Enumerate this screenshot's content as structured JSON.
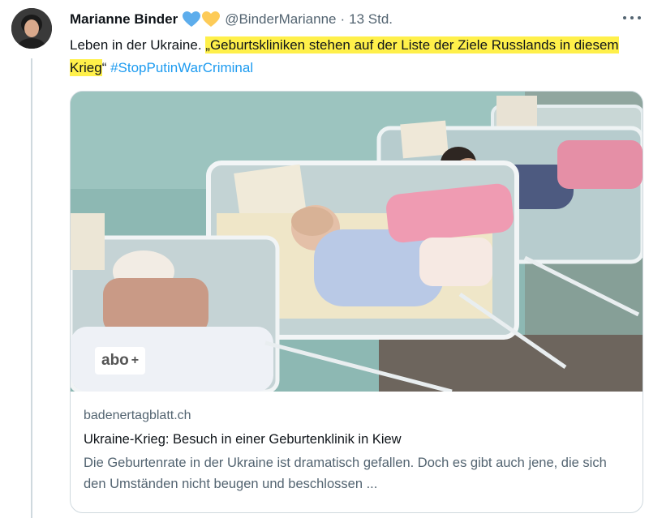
{
  "tweet": {
    "author_name": "Marianne Binder",
    "handle": "@BinderMarianne",
    "separator": "·",
    "time": "13 Std.",
    "badges": [
      "blue-heart-icon",
      "yellow-heart-icon"
    ],
    "text_prefix": "Leben in der Ukraine. ",
    "text_highlight": "„Geburtskliniken stehen auf der Liste der Ziele Russlands in diesem Krieg",
    "text_close_quote": "“ ",
    "hashtag": "#StopPutinWarCriminal",
    "highlight_color": "#fff04a",
    "hashtag_color": "#1d9bf0"
  },
  "card": {
    "image_badge_text": "abo",
    "image_badge_plus": "+",
    "domain": "badenertagblatt.ch",
    "title": "Ukraine-Krieg: Besuch in einer Geburtenklinik in Kiew",
    "description": "Die Geburtenrate in der Ukraine ist dramatisch gefallen. Doch es gibt auch jene, die sich den Umständen nicht beugen und beschlossen ..."
  },
  "icons": {
    "more": "more-options-icon",
    "avatar": "avatar"
  }
}
